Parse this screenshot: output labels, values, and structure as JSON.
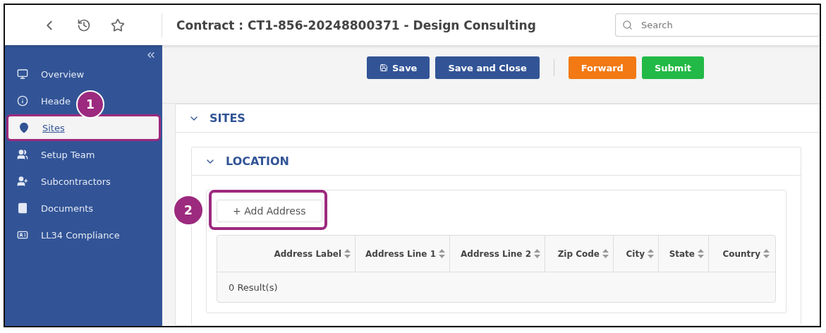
{
  "header": {
    "title": "Contract : CT1-856-20248800371 - Design Consulting",
    "search": {
      "placeholder": "Search"
    }
  },
  "sidebar": {
    "items": [
      {
        "label": "Overview",
        "selected": false
      },
      {
        "label": "Heade",
        "selected": false
      },
      {
        "label": "Sites",
        "selected": true
      },
      {
        "label": "Setup Team",
        "selected": false
      },
      {
        "label": "Subcontractors",
        "selected": false
      },
      {
        "label": "Documents",
        "selected": false
      },
      {
        "label": "LL34 Compliance",
        "selected": false
      }
    ]
  },
  "toolbar": {
    "buttons": [
      {
        "label": "Save",
        "kind": "primary"
      },
      {
        "label": "Save and Close",
        "kind": "primary"
      },
      {
        "label": "Forward",
        "kind": "warning"
      },
      {
        "label": "Submit",
        "kind": "success"
      }
    ]
  },
  "sites_panel": {
    "title": "SITES",
    "location_panel": {
      "title": "LOCATION",
      "add_button": "+ Add Address",
      "table": {
        "columns": [
          "Address Label",
          "Address Line 1",
          "Address Line 2",
          "Zip Code",
          "City",
          "State",
          "Country"
        ],
        "footer": "0 Result(s)"
      }
    }
  },
  "annotations": [
    {
      "number": "1"
    },
    {
      "number": "2"
    }
  ]
}
